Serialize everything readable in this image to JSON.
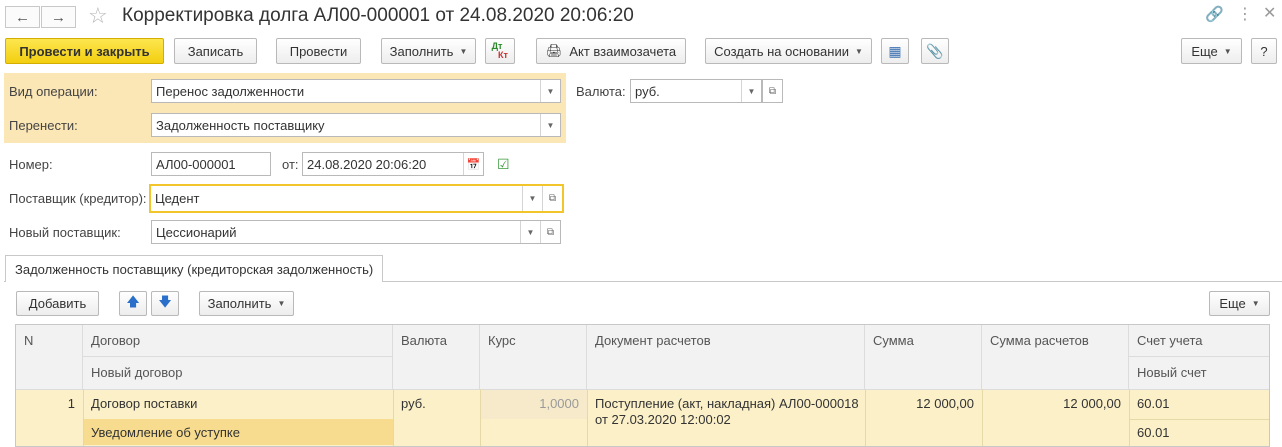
{
  "window": {
    "title": "Корректировка долга АЛ00-000001 от 24.08.2020 20:06:20"
  },
  "toolbar": {
    "post_and_close": "Провести и закрыть",
    "save": "Записать",
    "post": "Провести",
    "fill": "Заполнить",
    "dt_kt_top": "Дт",
    "dt_kt_bottom": "Кт",
    "offset_act": "Акт взаимозачета",
    "create_based_on": "Создать на основании",
    "more": "Еще",
    "help": "?"
  },
  "form": {
    "operation_label": "Вид операции:",
    "operation_value": "Перенос задолженности",
    "transfer_label": "Перенести:",
    "transfer_value": "Задолженность поставщику",
    "currency_label": "Валюта:",
    "currency_value": "руб.",
    "number_label": "Номер:",
    "number_value": "АЛ00-000001",
    "date_label": "от:",
    "date_value": "24.08.2020 20:06:20",
    "supplier_label": "Поставщик (кредитор):",
    "supplier_value": "Цедент",
    "new_supplier_label": "Новый поставщик:",
    "new_supplier_value": "Цессионарий"
  },
  "tab": {
    "label": "Задолженность поставщику (кредиторская задолженность)"
  },
  "table_toolbar": {
    "add": "Добавить",
    "fill": "Заполнить",
    "more": "Еще"
  },
  "table": {
    "headers": {
      "n": "N",
      "contract": "Договор",
      "new_contract": "Новый договор",
      "currency": "Валюта",
      "rate": "Курс",
      "settlement_doc": "Документ расчетов",
      "amount": "Сумма",
      "settlement_amount": "Сумма расчетов",
      "account": "Счет учета",
      "new_account": "Новый счет"
    },
    "rows": [
      {
        "n": "1",
        "contract": "Договор поставки",
        "new_contract": "Уведомление об уступке",
        "currency": "руб.",
        "rate": "1,0000",
        "settlement_doc_line1": "Поступление (акт, накладная) АЛ00-000018",
        "settlement_doc_line2": "от 27.03.2020 12:00:02",
        "amount": "12 000,00",
        "settlement_amount": "12 000,00",
        "account": "60.01",
        "new_account": "60.01"
      }
    ]
  }
}
